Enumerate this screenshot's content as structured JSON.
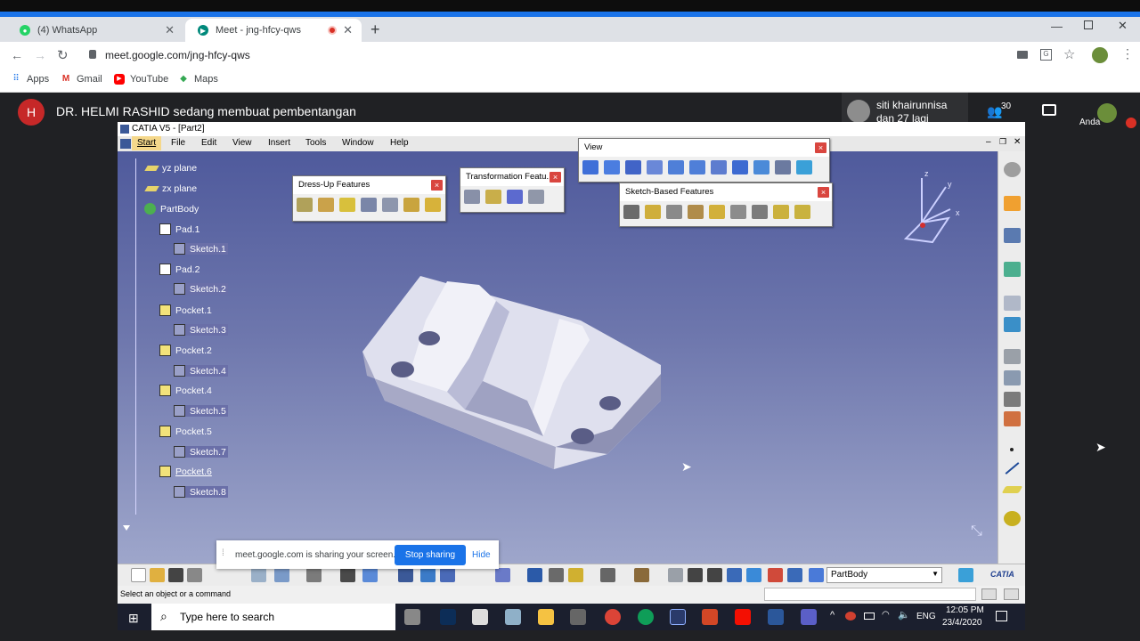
{
  "browser": {
    "tabs": [
      {
        "label": "(4) WhatsApp"
      },
      {
        "label": "Meet - jng-hfcy-qws"
      }
    ],
    "url": "meet.google.com/jng-hfcy-qws",
    "bookmarks": [
      "Apps",
      "Gmail",
      "YouTube",
      "Maps"
    ]
  },
  "meet": {
    "presenter_initial": "H",
    "presenting_text": "DR. HELMI RASHID sedang membuat pembentangan",
    "participant_name": "siti khairunnisa",
    "participant_more": "dan 27 lagi",
    "participant_count": "30",
    "self_label": "Anda",
    "share_banner": {
      "text": "meet.google.com is sharing your screen.",
      "stop_label": "Stop sharing",
      "hide_label": "Hide"
    }
  },
  "catia": {
    "title": "CATIA V5 - [Part2]",
    "menu": [
      "Start",
      "File",
      "Edit",
      "View",
      "Insert",
      "Tools",
      "Window",
      "Help"
    ],
    "tree": [
      {
        "label": "yz plane",
        "icon": "plane-icon"
      },
      {
        "label": "zx plane",
        "icon": "plane-icon"
      },
      {
        "label": "PartBody",
        "icon": "partbody-icon"
      },
      {
        "label": "Pad.1",
        "icon": "pad-icon"
      },
      {
        "label": "Sketch.1",
        "icon": "sketch-icon"
      },
      {
        "label": "Pad.2",
        "icon": "pad-icon"
      },
      {
        "label": "Sketch.2",
        "icon": "sketch-icon"
      },
      {
        "label": "Pocket.1",
        "icon": "pocket-icon"
      },
      {
        "label": "Sketch.3",
        "icon": "sketch-icon"
      },
      {
        "label": "Pocket.2",
        "icon": "pocket-icon"
      },
      {
        "label": "Sketch.4",
        "icon": "sketch-icon"
      },
      {
        "label": "Pocket.4",
        "icon": "pocket-icon"
      },
      {
        "label": "Sketch.5",
        "icon": "sketch-icon"
      },
      {
        "label": "Pocket.5",
        "icon": "pocket-icon"
      },
      {
        "label": "Sketch.7",
        "icon": "sketch-icon"
      },
      {
        "label": "Pocket.6",
        "icon": "pocket-icon"
      },
      {
        "label": "Sketch.8",
        "icon": "sketch-icon"
      }
    ],
    "toolbars": {
      "dressup": "Dress-Up Features",
      "transformation": "Transformation Featu...",
      "view": "View",
      "sketch_based": "Sketch-Based Features"
    },
    "axis_labels": {
      "x": "x",
      "y": "y",
      "z": "z"
    },
    "body_select": "PartBody",
    "status_text": "Select an object or a command",
    "brand": "CATIA"
  },
  "taskbar": {
    "search_placeholder": "Type here to search",
    "language": "ENG",
    "time": "12:05 PM",
    "date": "23/4/2020"
  }
}
